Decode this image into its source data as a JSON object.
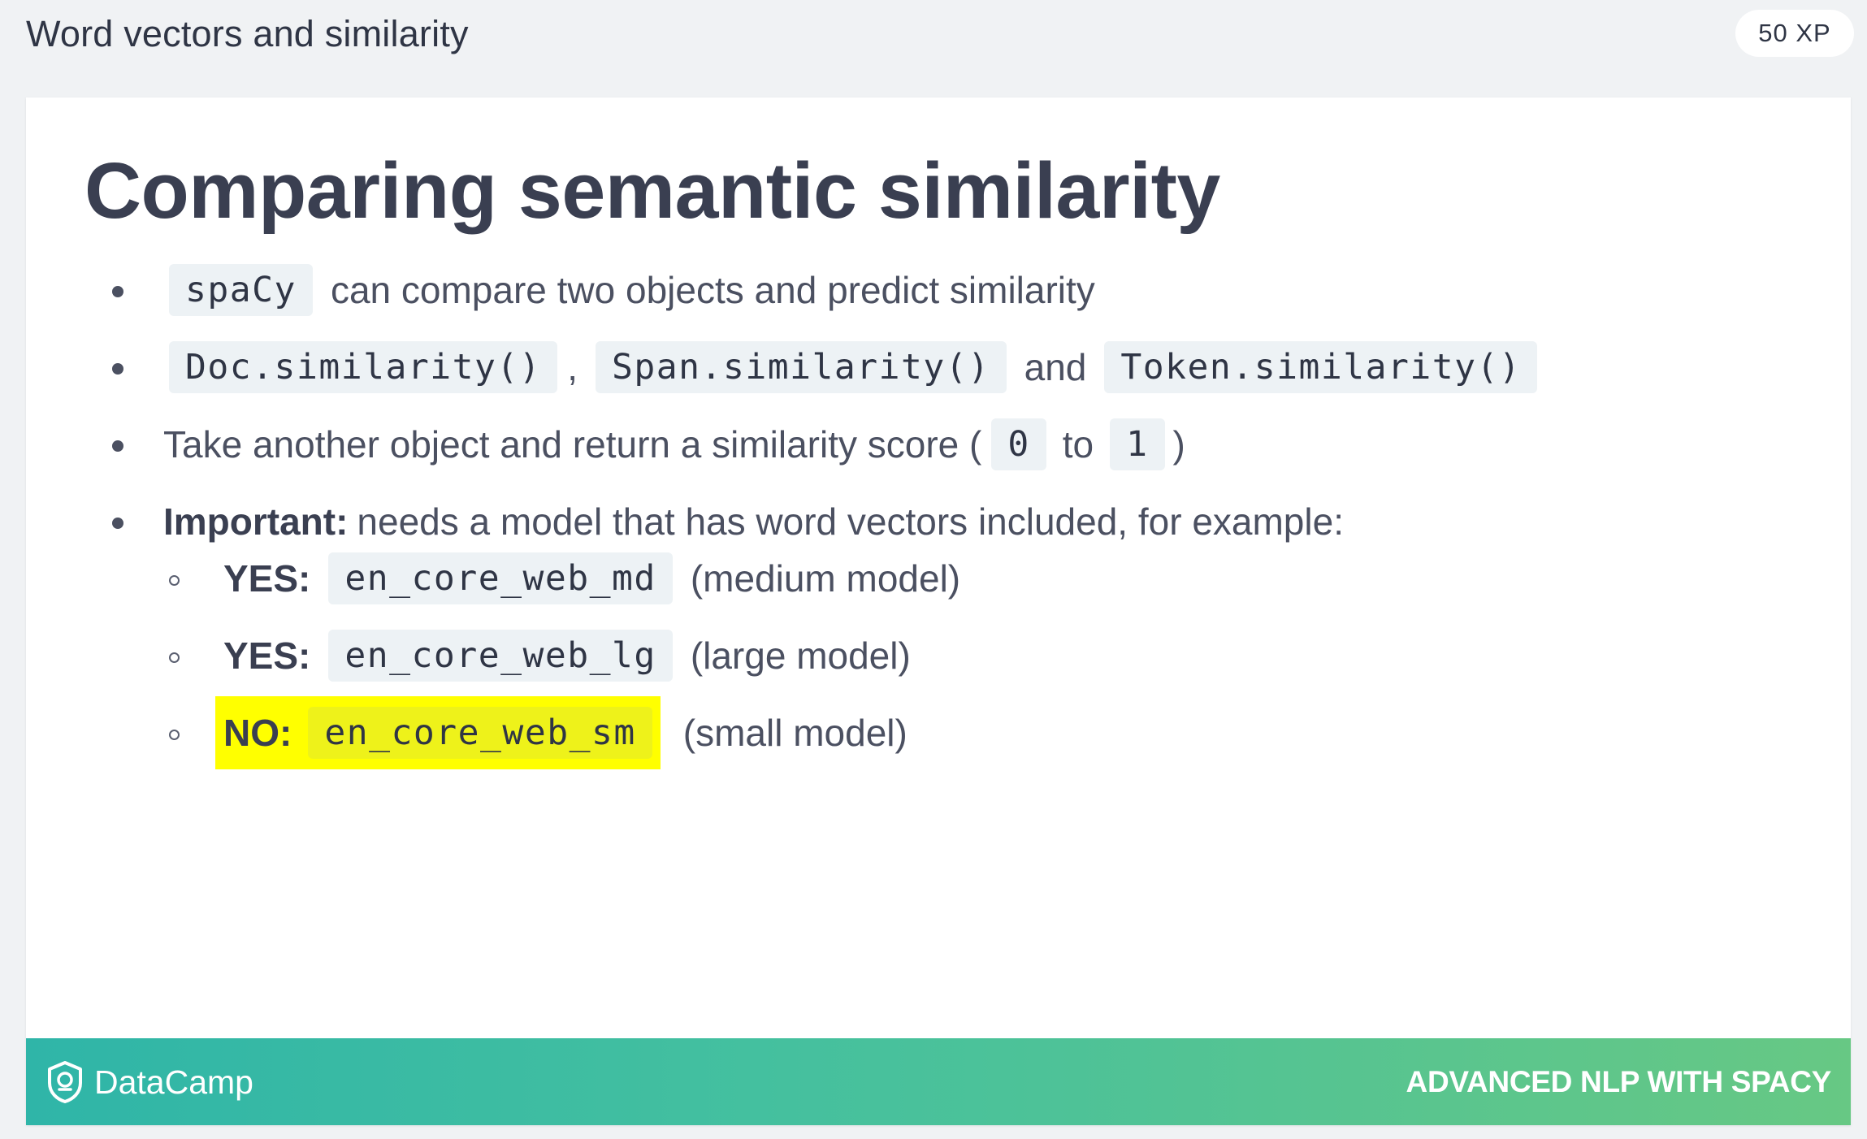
{
  "header": {
    "lesson_title": "Word vectors and similarity",
    "xp": "50 XP"
  },
  "slide": {
    "title": "Comparing semantic similarity",
    "bullet1": {
      "code": "spaCy",
      "text": "can compare two objects and predict similarity"
    },
    "bullet2": {
      "code1": "Doc.similarity()",
      "sep": ",",
      "code2": "Span.similarity()",
      "and": "and",
      "code3": "Token.similarity()"
    },
    "bullet3": {
      "text": "Take another object and return a similarity score (",
      "code1": "0",
      "to": "to",
      "code2": "1",
      "close": ")"
    },
    "bullet4": {
      "strong": "Important:",
      "text": "needs a model that has word vectors included, for example:"
    },
    "sub_items": [
      {
        "label": "YES:",
        "code": "en_core_web_md",
        "text": "(medium model)"
      },
      {
        "label": "YES:",
        "code": "en_core_web_lg",
        "text": "(large model)"
      },
      {
        "label": "NO:",
        "code": "en_core_web_sm",
        "text": "(small model)"
      }
    ]
  },
  "footer": {
    "brand": "DataCamp",
    "course": "ADVANCED NLP WITH SPACY"
  },
  "colors": {
    "highlight": "#ffff00",
    "footer_gradient_start": "#2fb5a8",
    "footer_gradient_end": "#67c884"
  },
  "icons": {
    "brand_logo": "datacamp-shield-icon"
  }
}
